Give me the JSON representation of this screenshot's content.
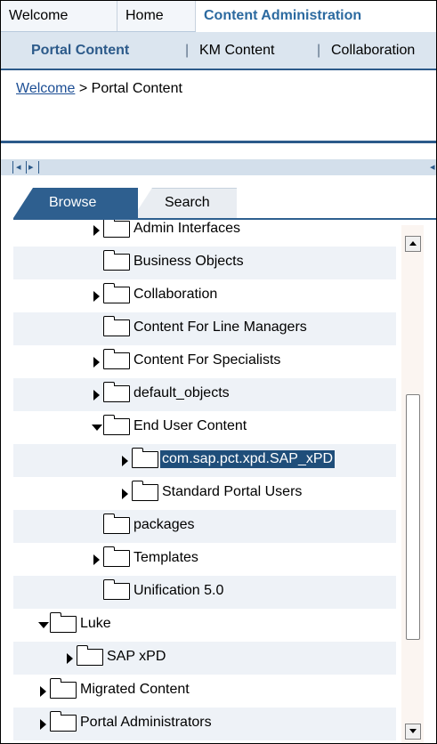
{
  "top_tabs": [
    "Welcome",
    "Home",
    "Content Administration"
  ],
  "sub_tabs": {
    "portal": "Portal Content",
    "km": "KM Content",
    "collab": "Collaboration",
    "separator": "|"
  },
  "breadcrumb": {
    "link": "Welcome",
    "separator": ">",
    "current": "Portal Content"
  },
  "pager": {
    "first": "|◂",
    "prev": "|▸",
    "right": "◂"
  },
  "browse_tabs": {
    "browse": "Browse",
    "search": "Search"
  },
  "tree": [
    {
      "label": "Admin Interfaces",
      "expander": "collapsed"
    },
    {
      "label": "Business Objects",
      "expander": "none"
    },
    {
      "label": "Collaboration",
      "expander": "collapsed"
    },
    {
      "label": "Content For Line Managers",
      "expander": "none"
    },
    {
      "label": "Content For Specialists",
      "expander": "collapsed"
    },
    {
      "label": "default_objects",
      "expander": "collapsed"
    },
    {
      "label": "End User Content",
      "expander": "expanded"
    },
    {
      "label": "com.sap.pct.xpd.SAP_xPD",
      "expander": "collapsed",
      "selected": true
    },
    {
      "label": "Standard Portal Users",
      "expander": "collapsed"
    },
    {
      "label": "packages",
      "expander": "none"
    },
    {
      "label": "Templates",
      "expander": "collapsed"
    },
    {
      "label": "Unification 5.0",
      "expander": "none"
    },
    {
      "label": "Luke",
      "expander": "expanded"
    },
    {
      "label": "SAP xPD",
      "expander": "collapsed"
    },
    {
      "label": "Migrated Content",
      "expander": "collapsed"
    },
    {
      "label": "Portal Administrators",
      "expander": "collapsed"
    }
  ],
  "colors": {
    "accent": "#2c5a8a",
    "selection": "#1f4e7a",
    "tab_active_text": "#2c6aa0"
  }
}
